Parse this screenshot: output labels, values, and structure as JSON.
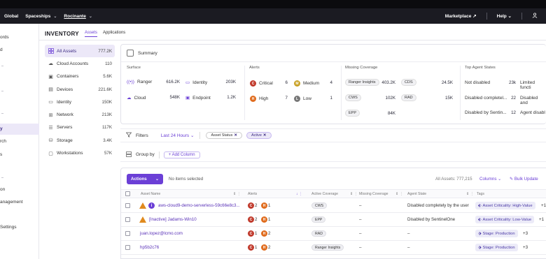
{
  "topbar": {
    "crumbs": [
      "Global",
      "Spaceships",
      "Rocinante"
    ],
    "right": [
      "Marketplace",
      "Help"
    ],
    "icons": [
      "external-link-icon",
      "chevron-down-icon",
      "user-icon"
    ]
  },
  "leftnav": {
    "items": [
      "ords",
      "d",
      "y",
      "rch",
      "s",
      "on",
      "anagement",
      "Settings"
    ]
  },
  "header": {
    "title": "INVENTORY",
    "tabs": [
      "Assets",
      "Applications"
    ]
  },
  "asset_list": [
    {
      "label": "All Assets",
      "count": "777.2K",
      "icon": "grid-icon"
    },
    {
      "label": "Cloud Accounts",
      "count": "110",
      "icon": "cloud-icon"
    },
    {
      "label": "Containers",
      "count": "5.6K",
      "icon": "container-icon"
    },
    {
      "label": "Devices",
      "count": "221.6K",
      "icon": "device-icon"
    },
    {
      "label": "Identity",
      "count": "150K",
      "icon": "identity-icon"
    },
    {
      "label": "Network",
      "count": "213K",
      "icon": "network-icon"
    },
    {
      "label": "Servers",
      "count": "117K",
      "icon": "server-icon"
    },
    {
      "label": "Storage",
      "count": "3.4K",
      "icon": "storage-icon"
    },
    {
      "label": "Workstations",
      "count": "57K",
      "icon": "workstation-icon"
    }
  ],
  "summary": {
    "title": "Summary",
    "surface": {
      "title": "Surface",
      "items": [
        {
          "label": "Ranger",
          "value": "616.2K"
        },
        {
          "label": "Identity",
          "value": "203K"
        },
        {
          "label": "Cloud",
          "value": "548K"
        },
        {
          "label": "Endpoint",
          "value": "1.2K"
        }
      ]
    },
    "alerts": {
      "title": "Alerts",
      "items": [
        {
          "label": "Critical",
          "value": "6",
          "letter": "C",
          "color": "#c0392b"
        },
        {
          "label": "Medium",
          "value": "4",
          "letter": "M",
          "color": "#c9a227"
        },
        {
          "label": "High",
          "value": "7",
          "letter": "H",
          "color": "#e06c1e"
        },
        {
          "label": "Low",
          "value": "1",
          "letter": "L",
          "color": "#777777"
        }
      ]
    },
    "missing": {
      "title": "Missing Coverage",
      "items": [
        {
          "label": "Ranger Insights",
          "value": "403.2K"
        },
        {
          "label": "CDS",
          "value": "24.5K"
        },
        {
          "label": "CWS",
          "value": "102K"
        },
        {
          "label": "RAD",
          "value": "15K"
        },
        {
          "label": "EPP",
          "value": "84K"
        }
      ]
    },
    "top_agent": {
      "title": "Top Agent States",
      "items": [
        {
          "label": "Not disabled",
          "value": "23k"
        },
        {
          "label": "Limited functi",
          "value": ""
        },
        {
          "label": "Disabled completel...",
          "value": "22"
        },
        {
          "label": "Disabled and",
          "value": ""
        },
        {
          "label": "Disabled by Sentin...",
          "value": "12"
        },
        {
          "label": "Agent disabl",
          "value": ""
        }
      ]
    }
  },
  "filters": {
    "label": "Filters",
    "time": "Last 24 Hours",
    "chips": [
      {
        "label": "Asset Status"
      },
      {
        "label": "Active"
      }
    ]
  },
  "groupby": {
    "label": "Group by",
    "add_column": "+ Add Column"
  },
  "table": {
    "actions": "Actions",
    "no_items": "No items selected",
    "all_assets": "All Assets: 777,215",
    "columns": "Columns",
    "bulk_update": "Bulk Update",
    "headers": [
      "Asset Name",
      "Alerts",
      "Active Coverage",
      "Missing Coverage",
      "Agent State",
      "Tags"
    ],
    "rows": [
      {
        "name": "aws-cloud9-demo-serverless-59c66e8c3...",
        "warn": true,
        "badge": "i",
        "a1": "2",
        "a2": "1",
        "coverage": "CWS",
        "missing": "–",
        "agent": "Disabled completely by the user",
        "tag": "Asset Criticality: High-Value",
        "more": "+1"
      },
      {
        "name": "[Inactive] Jadams-Win10",
        "warn": true,
        "badge": "",
        "a1": "2",
        "a2": "1",
        "coverage": "EPP",
        "missing": "–",
        "agent": "Disabled by SentinelOne",
        "tag": "Asset Criticality: Low-Value",
        "more": "+1"
      },
      {
        "name": "juan.lopez@lcmo.com",
        "warn": false,
        "badge": "",
        "a1": "1",
        "a2": "2",
        "coverage": "RAD",
        "missing": "–",
        "agent": "–",
        "tag": "Stage: Production",
        "more": "+3"
      },
      {
        "name": "hp5b2c76",
        "warn": false,
        "badge": "",
        "a1": "1",
        "a2": "2",
        "coverage": "Ranger Insights",
        "missing": "–",
        "agent": "–",
        "tag": "Stage: Production",
        "more": "+3"
      }
    ]
  }
}
